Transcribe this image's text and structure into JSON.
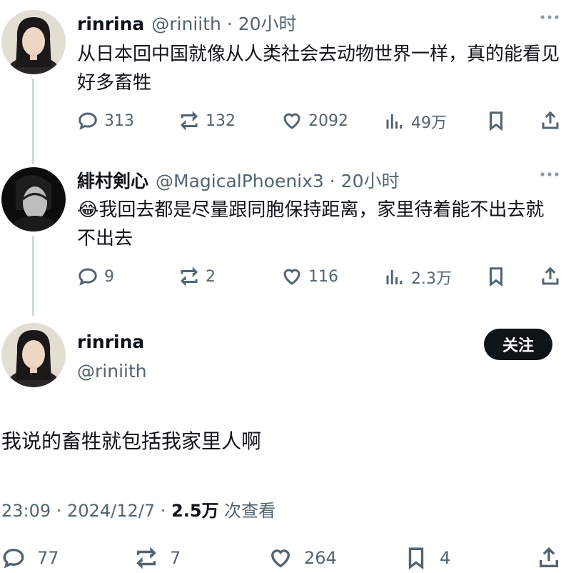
{
  "tweet1": {
    "name": "rinrina",
    "handle_time": "@riniith · 20小时",
    "text": "从日本回中国就像从人类社会去动物世界一样，真的能看见好多畜牲",
    "replies": "313",
    "retweets": "132",
    "likes": "2092",
    "views": "49万"
  },
  "tweet2": {
    "name": "緋村剣心",
    "handle_time": "@MagicalPhoenix3 · 20小时",
    "emoji": "😂",
    "text": "我回去都是尽量跟同胞保持距离，家里待着能不出去就不出去",
    "replies": "9",
    "retweets": "2",
    "likes": "116",
    "views": "2.3万"
  },
  "main": {
    "name": "rinrina",
    "handle": "@riniith",
    "follow_label": "关注",
    "text": "我说的畜牲就包括我家里人啊",
    "timestamp": "23:09 · 2024/12/7 · ",
    "views_count": "2.5万",
    "views_label": " 次查看",
    "replies": "77",
    "retweets": "7",
    "likes": "264",
    "bookmarks": "4"
  },
  "icons": {
    "more": "more-icon",
    "reply": "reply-icon",
    "retweet": "retweet-icon",
    "like": "heart-icon",
    "views": "views-icon",
    "bookmark": "bookmark-icon",
    "share": "share-icon"
  },
  "colors": {
    "text": "#0f1419",
    "secondary": "#536471",
    "thread_line": "#cfd9de",
    "follow_button": "#0f1419"
  }
}
